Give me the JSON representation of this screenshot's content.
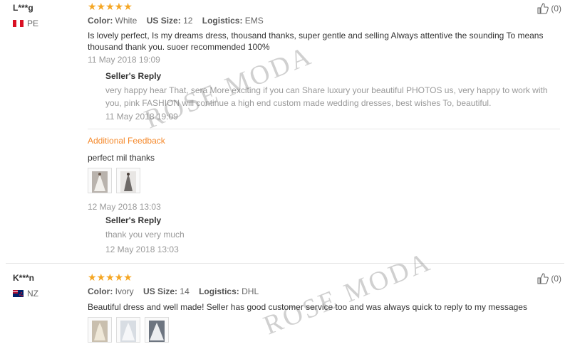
{
  "watermark": "ROSE MODA",
  "reviews": [
    {
      "user": "L***g",
      "country": "PE",
      "stars": "★★★★★",
      "helpful_count": "(0)",
      "attrs": {
        "color_label": "Color:",
        "color_value": "White",
        "size_label": "US Size:",
        "size_value": "12",
        "logistics_label": "Logistics:",
        "logistics_value": "EMS"
      },
      "text": "Is lovely perfect, Is my dreams dress, thousand thanks, super gentle and selling Always attentive the sounding To means thousand thank you. suoer recommended 100%",
      "date": "11 May 2018 19:09",
      "reply": {
        "title": "Seller's Reply",
        "text": "very happy hear That, sera More exciting if you can Share luxury your beautiful PHOTOS us, very happy to work with you, pink FASHION will continue a high end custom made wedding dresses, best wishes To, beautiful.",
        "date": "11 May 2018 19:09"
      },
      "additional": {
        "label": "Additional Feedback",
        "text": "perfect mil thanks",
        "date": "12 May 2018 13:03",
        "reply": {
          "title": "Seller's Reply",
          "text": "thank you very much",
          "date": "12 May 2018 13:03"
        }
      }
    },
    {
      "user": "K***n",
      "country": "NZ",
      "stars": "★★★★★",
      "helpful_count": "(0)",
      "attrs": {
        "color_label": "Color:",
        "color_value": "Ivory",
        "size_label": "US Size:",
        "size_value": "14",
        "logistics_label": "Logistics:",
        "logistics_value": "DHL"
      },
      "text": "Beautiful dress and well made! Seller has good customer service too and was always quick to reply to my messages"
    }
  ],
  "colors": {
    "star": "#f5a623",
    "additional": "#f5892b",
    "muted": "#999999"
  }
}
